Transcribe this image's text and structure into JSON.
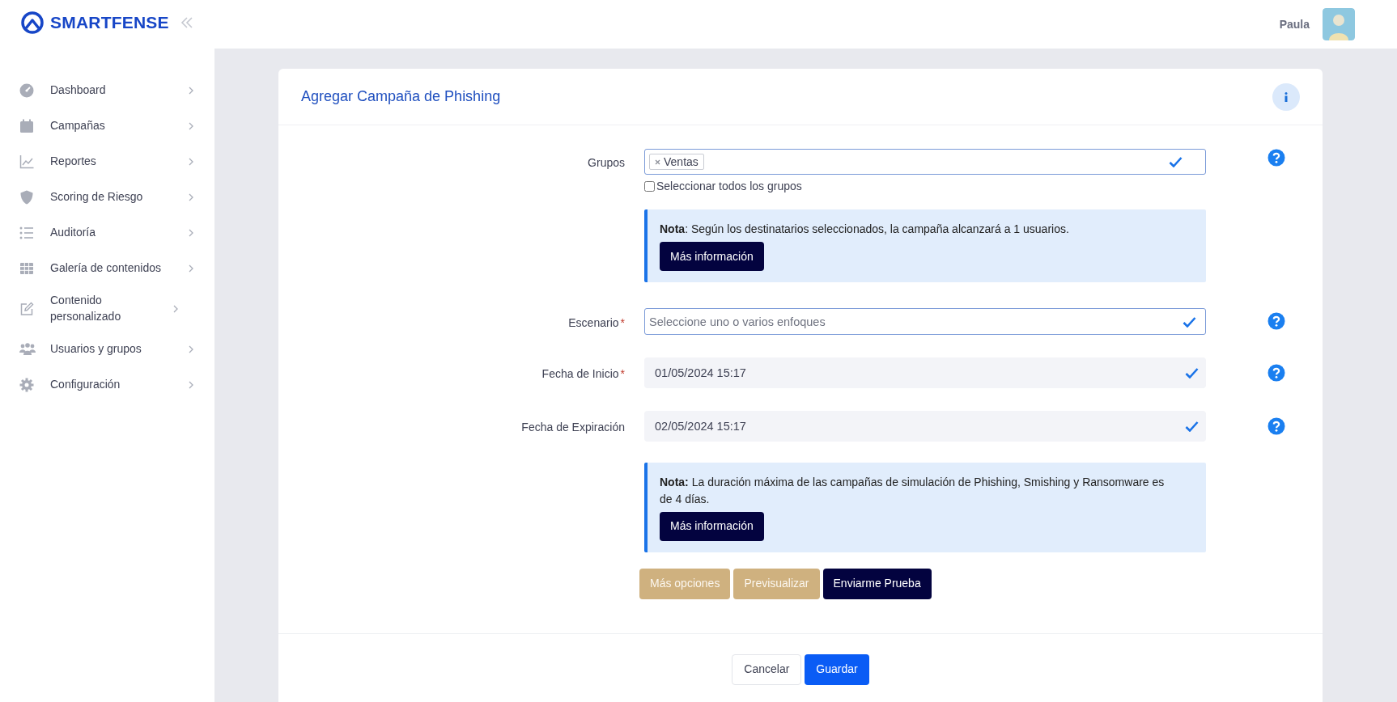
{
  "brand": {
    "name": "SMARTFENSE"
  },
  "sidebar": {
    "items": [
      {
        "label": "Dashboard"
      },
      {
        "label": "Campañas"
      },
      {
        "label": "Reportes"
      },
      {
        "label": "Scoring de Riesgo"
      },
      {
        "label": "Auditoría"
      },
      {
        "label": "Galería de contenidos"
      },
      {
        "label": "Contenido personalizado"
      },
      {
        "label": "Usuarios y grupos"
      },
      {
        "label": "Configuración"
      }
    ]
  },
  "user": {
    "name": "Paula"
  },
  "form": {
    "title": "Agregar Campaña de Phishing",
    "rows": [
      {
        "kind": "tags",
        "label": "Grupos",
        "tags": [
          "Ventas"
        ],
        "checkbox": {
          "label": "Seleccionar todos los grupos",
          "checked": false
        }
      },
      {
        "kind": "note",
        "text": "**Nota**: Según los destinatarios seleccionados, la campaña alcanzará a 1 usuarios.",
        "button": "Más información"
      },
      {
        "kind": "select",
        "label": "Escenario",
        "required_mark": "*",
        "placeholder": "Seleccione uno o varios enfoques"
      },
      {
        "kind": "date",
        "label": "Fecha de Inicio",
        "required_mark": "*",
        "value": "01/05/2024 15:17"
      },
      {
        "kind": "date",
        "label": "Fecha de Expiración",
        "value": "02/05/2024 15:17"
      },
      {
        "kind": "note",
        "text": "**Nota:** La duración máxima de las campañas de simulación de Phishing, Smishing y Ransomware es de 4 días.",
        "button": "Más información"
      }
    ],
    "actions": [
      {
        "label": "Más opciones",
        "kind": "secondary"
      },
      {
        "label": "Previsualizar",
        "kind": "secondary"
      },
      {
        "label": "Enviarme Prueba",
        "kind": "dark"
      }
    ],
    "footer": [
      {
        "label": "Cancelar",
        "kind": "outline"
      },
      {
        "label": "Guardar",
        "kind": "primary"
      }
    ]
  }
}
